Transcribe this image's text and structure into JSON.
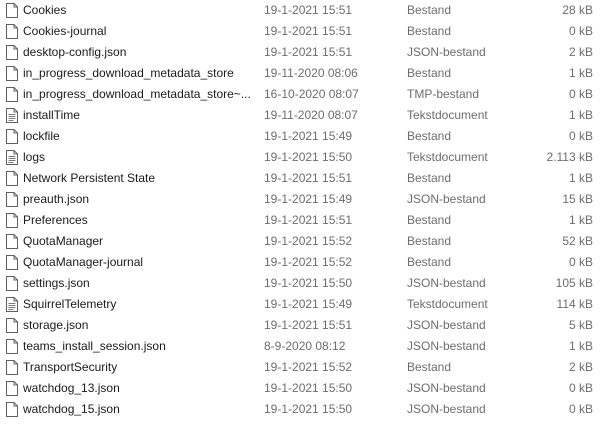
{
  "files": [
    {
      "name": "Cookies",
      "date": "19-1-2021 15:51",
      "type": "Bestand",
      "size": "28 kB",
      "icon": "blank-file-icon"
    },
    {
      "name": "Cookies-journal",
      "date": "19-1-2021 15:51",
      "type": "Bestand",
      "size": "0 kB",
      "icon": "blank-file-icon"
    },
    {
      "name": "desktop-config.json",
      "date": "19-1-2021 15:51",
      "type": "JSON-bestand",
      "size": "2 kB",
      "icon": "blank-file-icon"
    },
    {
      "name": "in_progress_download_metadata_store",
      "date": "19-11-2020 08:06",
      "type": "Bestand",
      "size": "1 kB",
      "icon": "blank-file-icon"
    },
    {
      "name": "in_progress_download_metadata_store~...",
      "date": "16-10-2020 08:07",
      "type": "TMP-bestand",
      "size": "0 kB",
      "icon": "blank-file-icon"
    },
    {
      "name": "installTime",
      "date": "19-11-2020 08:07",
      "type": "Tekstdocument",
      "size": "1 kB",
      "icon": "text-file-icon"
    },
    {
      "name": "lockfile",
      "date": "19-1-2021 15:49",
      "type": "Bestand",
      "size": "0 kB",
      "icon": "blank-file-icon"
    },
    {
      "name": "logs",
      "date": "19-1-2021 15:50",
      "type": "Tekstdocument",
      "size": "2.113 kB",
      "icon": "text-file-icon"
    },
    {
      "name": "Network Persistent State",
      "date": "19-1-2021 15:51",
      "type": "Bestand",
      "size": "1 kB",
      "icon": "blank-file-icon"
    },
    {
      "name": "preauth.json",
      "date": "19-1-2021 15:49",
      "type": "JSON-bestand",
      "size": "15 kB",
      "icon": "blank-file-icon"
    },
    {
      "name": "Preferences",
      "date": "19-1-2021 15:51",
      "type": "Bestand",
      "size": "1 kB",
      "icon": "blank-file-icon"
    },
    {
      "name": "QuotaManager",
      "date": "19-1-2021 15:52",
      "type": "Bestand",
      "size": "52 kB",
      "icon": "blank-file-icon"
    },
    {
      "name": "QuotaManager-journal",
      "date": "19-1-2021 15:52",
      "type": "Bestand",
      "size": "0 kB",
      "icon": "blank-file-icon"
    },
    {
      "name": "settings.json",
      "date": "19-1-2021 15:50",
      "type": "JSON-bestand",
      "size": "105 kB",
      "icon": "blank-file-icon"
    },
    {
      "name": "SquirrelTelemetry",
      "date": "19-1-2021 15:49",
      "type": "Tekstdocument",
      "size": "114 kB",
      "icon": "text-file-icon"
    },
    {
      "name": "storage.json",
      "date": "19-1-2021 15:51",
      "type": "JSON-bestand",
      "size": "5 kB",
      "icon": "blank-file-icon"
    },
    {
      "name": "teams_install_session.json",
      "date": "8-9-2020 08:12",
      "type": "JSON-bestand",
      "size": "1 kB",
      "icon": "blank-file-icon"
    },
    {
      "name": "TransportSecurity",
      "date": "19-1-2021 15:52",
      "type": "Bestand",
      "size": "2 kB",
      "icon": "blank-file-icon"
    },
    {
      "name": "watchdog_13.json",
      "date": "19-1-2021 15:50",
      "type": "JSON-bestand",
      "size": "0 kB",
      "icon": "blank-file-icon"
    },
    {
      "name": "watchdog_15.json",
      "date": "19-1-2021 15:50",
      "type": "JSON-bestand",
      "size": "0 kB",
      "icon": "blank-file-icon"
    }
  ]
}
